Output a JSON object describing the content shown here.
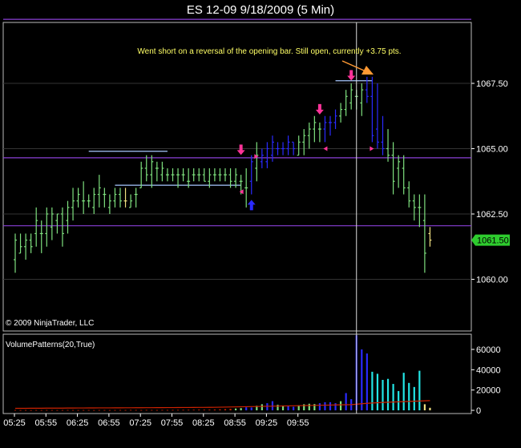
{
  "title": "ES 12-09  9/18/2009 (5 Min)",
  "copyright": "© 2009 NinjaTrader, LLC",
  "indicator_label": "VolumePatterns(20,True)",
  "price_badge": "1061.50",
  "annotation": "Went short on a reversal of the opening bar.  Still open, currently +3.75 pts.",
  "colors": {
    "background": "#000000",
    "up_bar": "#7ee07e",
    "down_bar": "#2a2aff",
    "neutral_bar": "#f0e080",
    "purple_line": "#8a3fd6",
    "blue_line": "#a8c8ff",
    "annotation_text": "#ffff66",
    "arrow": "#ff3399",
    "badge": "#2ecc2e",
    "cyan_volume": "#22e6e6",
    "avg_line": "#cc2200",
    "crosshair": "#dddddd",
    "annotation_arrow": "#ff9933"
  },
  "chart_data": [
    {
      "type": "ohlc",
      "title": "ES 12-09  9/18/2009 (5 Min)",
      "y_ticks": [
        "1067.50",
        "1065.00",
        "1062.50",
        "1060.00"
      ],
      "y_tick_values": [
        1067.5,
        1065.0,
        1062.5,
        1060.0
      ],
      "ylim": [
        1058.4,
        1070.6
      ],
      "x_ticks": [
        "05:25",
        "05:55",
        "06:25",
        "06:55",
        "07:25",
        "07:55",
        "08:25",
        "08:55",
        "09:25",
        "09:55"
      ],
      "bars": [
        [
          1060.75,
          1060.25,
          1061.75,
          1061.5,
          "up"
        ],
        [
          1061.0,
          1061.0,
          1061.75,
          1061.25,
          "up"
        ],
        [
          1061.25,
          1060.75,
          1061.75,
          1061.5,
          "up"
        ],
        [
          1061.5,
          1061.0,
          1061.75,
          1061.25,
          "up"
        ],
        [
          1061.75,
          1061.25,
          1062.75,
          1062.25,
          "up"
        ],
        [
          1061.75,
          1061.0,
          1062.25,
          1061.75,
          "up"
        ],
        [
          1061.75,
          1061.25,
          1062.75,
          1062.5,
          "up"
        ],
        [
          1062.0,
          1061.5,
          1062.75,
          1062.5,
          "up"
        ],
        [
          1062.25,
          1061.75,
          1062.5,
          1062.5,
          "up"
        ],
        [
          1062.5,
          1061.25,
          1062.75,
          1061.75,
          "up"
        ],
        [
          1062.25,
          1061.75,
          1063.0,
          1062.75,
          "up"
        ],
        [
          1062.75,
          1062.25,
          1063.5,
          1063.0,
          "up"
        ],
        [
          1063.0,
          1062.75,
          1063.5,
          1063.25,
          "up"
        ],
        [
          1063.0,
          1062.5,
          1063.75,
          1063.0,
          "up"
        ],
        [
          1063.0,
          1062.75,
          1063.25,
          1063.0,
          "up"
        ],
        [
          1062.75,
          1062.5,
          1063.5,
          1063.25,
          "up"
        ],
        [
          1063.25,
          1062.75,
          1064.0,
          1063.5,
          "up"
        ],
        [
          1063.25,
          1062.75,
          1063.5,
          1063.25,
          "up"
        ],
        [
          1062.75,
          1062.5,
          1063.25,
          1063.0,
          "up"
        ],
        [
          1063.0,
          1062.75,
          1063.5,
          1063.25,
          "up"
        ],
        [
          1063.25,
          1062.75,
          1063.5,
          1063.0,
          "up"
        ],
        [
          1063.0,
          1062.75,
          1063.5,
          1063.0,
          "neutral"
        ],
        [
          1062.75,
          1062.75,
          1063.25,
          1063.0,
          "up"
        ],
        [
          1063.25,
          1062.75,
          1063.5,
          1063.25,
          "up"
        ],
        [
          1063.5,
          1063.5,
          1064.5,
          1064.25,
          "up"
        ],
        [
          1064.25,
          1063.75,
          1064.75,
          1064.0,
          "up"
        ],
        [
          1064.0,
          1063.5,
          1064.75,
          1064.5,
          "up"
        ],
        [
          1064.25,
          1063.75,
          1064.5,
          1064.25,
          "up"
        ],
        [
          1064.0,
          1063.75,
          1064.5,
          1064.25,
          "up"
        ],
        [
          1064.0,
          1063.75,
          1064.25,
          1064.0,
          "up"
        ],
        [
          1064.0,
          1063.75,
          1064.25,
          1064.0,
          "up"
        ],
        [
          1064.0,
          1063.5,
          1064.25,
          1064.0,
          "up"
        ],
        [
          1064.0,
          1063.75,
          1064.25,
          1064.0,
          "up"
        ],
        [
          1063.75,
          1063.5,
          1064.25,
          1063.75,
          "up"
        ],
        [
          1064.0,
          1063.75,
          1064.25,
          1064.0,
          "up"
        ],
        [
          1064.0,
          1063.75,
          1064.25,
          1064.0,
          "up"
        ],
        [
          1064.0,
          1063.75,
          1064.25,
          1063.75,
          "up"
        ],
        [
          1063.75,
          1063.5,
          1064.25,
          1064.0,
          "up"
        ],
        [
          1064.0,
          1063.75,
          1064.25,
          1064.0,
          "up"
        ],
        [
          1064.0,
          1063.75,
          1064.25,
          1064.0,
          "up"
        ],
        [
          1064.0,
          1063.75,
          1064.25,
          1064.0,
          "up"
        ],
        [
          1064.0,
          1063.5,
          1064.25,
          1063.75,
          "up"
        ],
        [
          1063.75,
          1063.5,
          1064.25,
          1064.0,
          "up"
        ],
        [
          1063.75,
          1063.25,
          1064.0,
          1063.75,
          "up"
        ],
        [
          1063.5,
          1062.75,
          1064.25,
          1063.5,
          "up"
        ],
        [
          1063.75,
          1063.25,
          1064.75,
          1064.5,
          "down"
        ],
        [
          1064.25,
          1063.75,
          1065.25,
          1064.75,
          "up"
        ],
        [
          1064.5,
          1064.25,
          1065.0,
          1064.75,
          "down"
        ],
        [
          1064.5,
          1064.25,
          1065.25,
          1065.0,
          "down"
        ],
        [
          1064.75,
          1064.5,
          1065.5,
          1065.25,
          "down"
        ],
        [
          1065.0,
          1064.75,
          1065.25,
          1065.0,
          "down"
        ],
        [
          1065.0,
          1064.75,
          1065.25,
          1065.0,
          "down"
        ],
        [
          1065.0,
          1064.75,
          1065.5,
          1065.25,
          "down"
        ],
        [
          1065.25,
          1064.75,
          1065.25,
          1065.0,
          "down"
        ],
        [
          1064.75,
          1064.75,
          1065.5,
          1065.25,
          "up"
        ],
        [
          1065.25,
          1064.75,
          1065.75,
          1065.5,
          "up"
        ],
        [
          1065.5,
          1065.0,
          1066.0,
          1065.75,
          "up"
        ],
        [
          1065.75,
          1065.25,
          1066.25,
          1066.0,
          "up"
        ],
        [
          1065.75,
          1065.25,
          1066.0,
          1065.75,
          "up"
        ],
        [
          1065.75,
          1065.25,
          1066.25,
          1066.0,
          "down"
        ],
        [
          1066.0,
          1065.5,
          1066.25,
          1066.0,
          "down"
        ],
        [
          1066.0,
          1065.75,
          1066.5,
          1066.25,
          "down"
        ],
        [
          1066.25,
          1066.0,
          1066.75,
          1066.5,
          "up"
        ],
        [
          1066.5,
          1066.25,
          1067.25,
          1067.0,
          "up"
        ],
        [
          1066.75,
          1066.5,
          1067.5,
          1067.25,
          "up"
        ],
        [
          1067.0,
          1066.5,
          1067.25,
          1067.0,
          "up"
        ],
        [
          1066.75,
          1066.25,
          1067.5,
          1067.25,
          "up"
        ],
        [
          1067.25,
          1066.75,
          1067.75,
          1067.0,
          "down"
        ],
        [
          1067.0,
          1065.25,
          1067.75,
          1065.5,
          "down"
        ],
        [
          1065.75,
          1065.0,
          1067.5,
          1065.25,
          "down"
        ],
        [
          1065.25,
          1064.75,
          1066.25,
          1065.0,
          "down"
        ],
        [
          1065.0,
          1064.5,
          1065.75,
          1064.75,
          "up"
        ],
        [
          1064.75,
          1063.25,
          1065.25,
          1063.75,
          "up"
        ],
        [
          1064.25,
          1063.5,
          1064.75,
          1064.5,
          "up"
        ],
        [
          1064.25,
          1063.25,
          1064.75,
          1063.5,
          "up"
        ],
        [
          1063.5,
          1062.75,
          1063.75,
          1063.0,
          "up"
        ],
        [
          1063.0,
          1062.25,
          1063.25,
          1062.75,
          "up"
        ],
        [
          1062.75,
          1062.0,
          1063.25,
          1062.75,
          "up"
        ],
        [
          1062.25,
          1060.25,
          1063.25,
          1061.0,
          "up"
        ],
        [
          1061.75,
          1061.25,
          1062.0,
          1061.5,
          "neutral"
        ]
      ],
      "horizontal_lines": [
        {
          "kind": "purple",
          "price": 1069.95
        },
        {
          "kind": "purple",
          "price": 1064.65
        },
        {
          "kind": "purple",
          "price": 1062.05
        },
        {
          "kind": "level",
          "price": 1067.6,
          "from_bar": 61,
          "to_bar": 68
        },
        {
          "kind": "level",
          "price": 1064.9,
          "from_bar": 14,
          "to_bar": 29
        },
        {
          "kind": "level",
          "price": 1063.6,
          "from_bar": 19,
          "to_bar": 43
        }
      ],
      "arrows": [
        {
          "dir": "down",
          "bar": 43,
          "price": 1064.85
        },
        {
          "dir": "up",
          "bar": 45,
          "price": 1062.95
        },
        {
          "dir": "down",
          "bar": 58,
          "price": 1066.4
        },
        {
          "dir": "down",
          "bar": 64,
          "price": 1067.7
        },
        {
          "dir": "tri-left",
          "bar": 59,
          "price": 1065.0
        },
        {
          "dir": "tri-left",
          "bar": 43,
          "price": 1063.35
        },
        {
          "dir": "tri-right",
          "bar": 68,
          "price": 1065.0
        },
        {
          "dir": "tri-right",
          "bar": 46,
          "price": 1064.7
        }
      ]
    },
    {
      "type": "bar",
      "title": "VolumePatterns(20,True)",
      "y_ticks": [
        "60000",
        "40000",
        "20000",
        "0"
      ],
      "y_tick_values": [
        60000,
        40000,
        20000,
        0
      ],
      "ylim": [
        0,
        76000
      ],
      "values": [
        {
          "v": 300,
          "c": "red"
        },
        {
          "v": 200,
          "c": "red"
        },
        {
          "v": 250,
          "c": "red"
        },
        {
          "v": 200,
          "c": "red"
        },
        {
          "v": 300,
          "c": "red"
        },
        {
          "v": 250,
          "c": "red"
        },
        {
          "v": 350,
          "c": "red"
        },
        {
          "v": 300,
          "c": "red"
        },
        {
          "v": 250,
          "c": "red"
        },
        {
          "v": 300,
          "c": "red"
        },
        {
          "v": 350,
          "c": "red"
        },
        {
          "v": 300,
          "c": "red"
        },
        {
          "v": 250,
          "c": "red"
        },
        {
          "v": 300,
          "c": "red"
        },
        {
          "v": 300,
          "c": "red"
        },
        {
          "v": 250,
          "c": "red"
        },
        {
          "v": 300,
          "c": "red"
        },
        {
          "v": 300,
          "c": "red"
        },
        {
          "v": 250,
          "c": "red"
        },
        {
          "v": 300,
          "c": "red"
        },
        {
          "v": 350,
          "c": "red"
        },
        {
          "v": 300,
          "c": "red"
        },
        {
          "v": 400,
          "c": "red"
        },
        {
          "v": 350,
          "c": "red"
        },
        {
          "v": 300,
          "c": "red"
        },
        {
          "v": 400,
          "c": "red"
        },
        {
          "v": 350,
          "c": "red"
        },
        {
          "v": 300,
          "c": "red"
        },
        {
          "v": 400,
          "c": "red"
        },
        {
          "v": 350,
          "c": "red"
        },
        {
          "v": 400,
          "c": "red"
        },
        {
          "v": 450,
          "c": "red"
        },
        {
          "v": 500,
          "c": "red"
        },
        {
          "v": 550,
          "c": "red"
        },
        {
          "v": 600,
          "c": "red"
        },
        {
          "v": 700,
          "c": "red"
        },
        {
          "v": 650,
          "c": "red"
        },
        {
          "v": 700,
          "c": "red"
        },
        {
          "v": 800,
          "c": "red"
        },
        {
          "v": 1000,
          "c": "red"
        },
        {
          "v": 1200,
          "c": "red"
        },
        {
          "v": 1500,
          "c": "red"
        },
        {
          "v": 1800,
          "c": "green"
        },
        {
          "v": 2200,
          "c": "green"
        },
        {
          "v": 3000,
          "c": "blue"
        },
        {
          "v": 2800,
          "c": "blue"
        },
        {
          "v": 4500,
          "c": "green"
        },
        {
          "v": 6000,
          "c": "green"
        },
        {
          "v": 7000,
          "c": "blue"
        },
        {
          "v": 9000,
          "c": "blue"
        },
        {
          "v": 5500,
          "c": "green"
        },
        {
          "v": 4800,
          "c": "green"
        },
        {
          "v": 4200,
          "c": "blue"
        },
        {
          "v": 3500,
          "c": "blue"
        },
        {
          "v": 5000,
          "c": "green"
        },
        {
          "v": 6000,
          "c": "green"
        },
        {
          "v": 6500,
          "c": "green"
        },
        {
          "v": 6200,
          "c": "green"
        },
        {
          "v": 7000,
          "c": "blue"
        },
        {
          "v": 8000,
          "c": "blue"
        },
        {
          "v": 8000,
          "c": "blue"
        },
        {
          "v": 7000,
          "c": "blue"
        },
        {
          "v": 9000,
          "c": "green"
        },
        {
          "v": 17000,
          "c": "blue"
        },
        {
          "v": 11000,
          "c": "blue"
        },
        {
          "v": 74000,
          "c": "blue"
        },
        {
          "v": 60000,
          "c": "blue"
        },
        {
          "v": 56000,
          "c": "blue"
        },
        {
          "v": 38000,
          "c": "cyan"
        },
        {
          "v": 36000,
          "c": "cyan"
        },
        {
          "v": 30000,
          "c": "cyan"
        },
        {
          "v": 31000,
          "c": "cyan"
        },
        {
          "v": 26000,
          "c": "cyan"
        },
        {
          "v": 19000,
          "c": "cyan"
        },
        {
          "v": 37000,
          "c": "cyan"
        },
        {
          "v": 27000,
          "c": "cyan"
        },
        {
          "v": 23000,
          "c": "cyan"
        },
        {
          "v": 39000,
          "c": "cyan"
        },
        {
          "v": 6000,
          "c": "neutral"
        },
        {
          "v": 2500,
          "c": "neutral"
        }
      ],
      "average_line": [
        2000,
        2000,
        2000,
        2100,
        2100,
        2100,
        2150,
        2150,
        2200,
        2200,
        2250,
        2250,
        2300,
        2300,
        2350,
        2350,
        2400,
        2400,
        2400,
        2450,
        2450,
        2500,
        2500,
        2550,
        2550,
        2600,
        2600,
        2650,
        2650,
        2700,
        2700,
        2750,
        2800,
        2800,
        2850,
        2900,
        2900,
        2950,
        3000,
        3100,
        3200,
        3300,
        3400,
        3500,
        3600,
        3700,
        3800,
        3900,
        4000,
        4100,
        4200,
        4300,
        4400,
        4500,
        4600,
        4700,
        4800,
        4900,
        5000,
        5100,
        5200,
        5300,
        5400,
        5500,
        5600,
        6000,
        6500,
        6900,
        7200,
        7500,
        7800,
        8000,
        8200,
        8400,
        8600,
        8800,
        9000,
        9200,
        9400,
        9600
      ]
    }
  ]
}
